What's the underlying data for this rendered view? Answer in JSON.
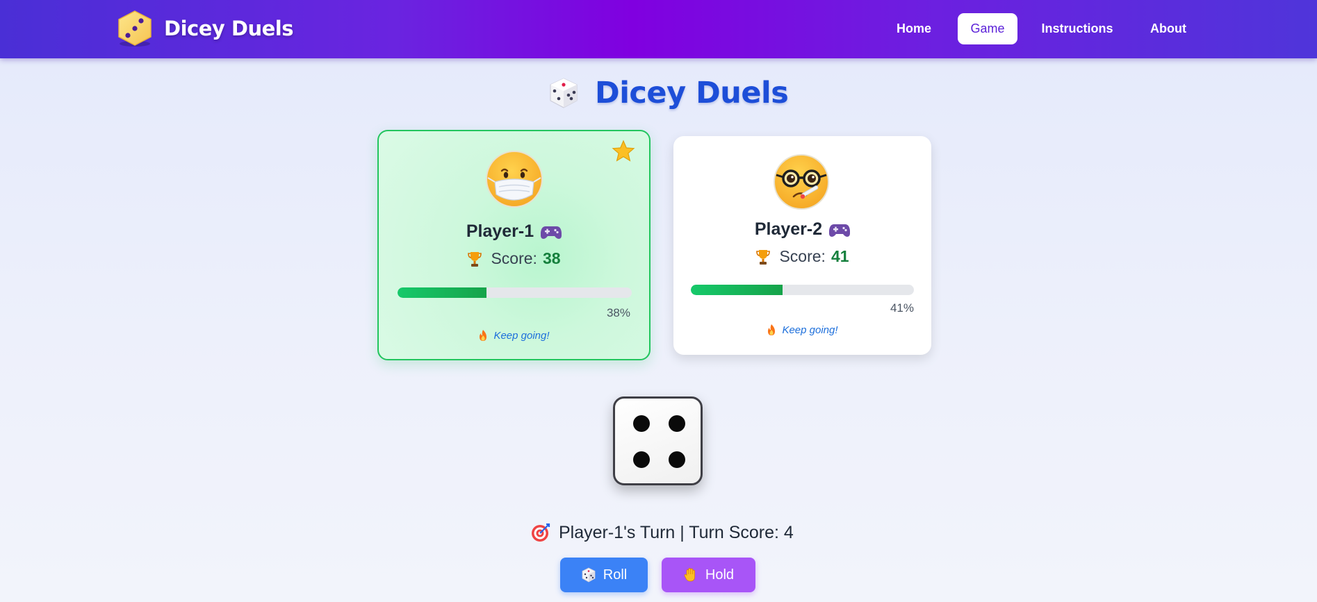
{
  "nav": {
    "brand": "Dicey Duels",
    "links": [
      "Home",
      "Game",
      "Instructions",
      "About"
    ],
    "active": "Game"
  },
  "page": {
    "title": "Dicey Duels"
  },
  "players": [
    {
      "name": "Player-1",
      "score_label": "Score:",
      "score": "38",
      "progress": 0.38,
      "progress_label": "38%",
      "message": "Keep going!",
      "active": true
    },
    {
      "name": "Player-2",
      "score_label": "Score:",
      "score": "41",
      "progress": 0.41,
      "progress_label": "41%",
      "message": "Keep going!",
      "active": false
    }
  ],
  "die": {
    "value": 4
  },
  "turn": {
    "text": "Player-1's Turn | Turn Score: 4"
  },
  "controls": {
    "roll_label": "Roll",
    "hold_label": "Hold"
  },
  "colors": {
    "accent_blue": "#1d4ed8",
    "active_card_border": "#22c55e",
    "score_green": "#15803d",
    "roll_button": "#3b82f6",
    "hold_button": "#a855f7"
  },
  "icons": {
    "brand": "dice-logo-icon",
    "title": "dice-icon",
    "player_1_avatar": "face-with-medical-mask-icon",
    "player_2_avatar": "nerd-face-with-thermometer-icon",
    "active_marker": "star-icon",
    "name_suffix": "gamepad-icon",
    "score_prefix": "trophy-icon",
    "message_prefix": "fire-icon",
    "turn_prefix": "target-icon",
    "roll": "dice-icon",
    "hold": "raised-hand-icon"
  }
}
